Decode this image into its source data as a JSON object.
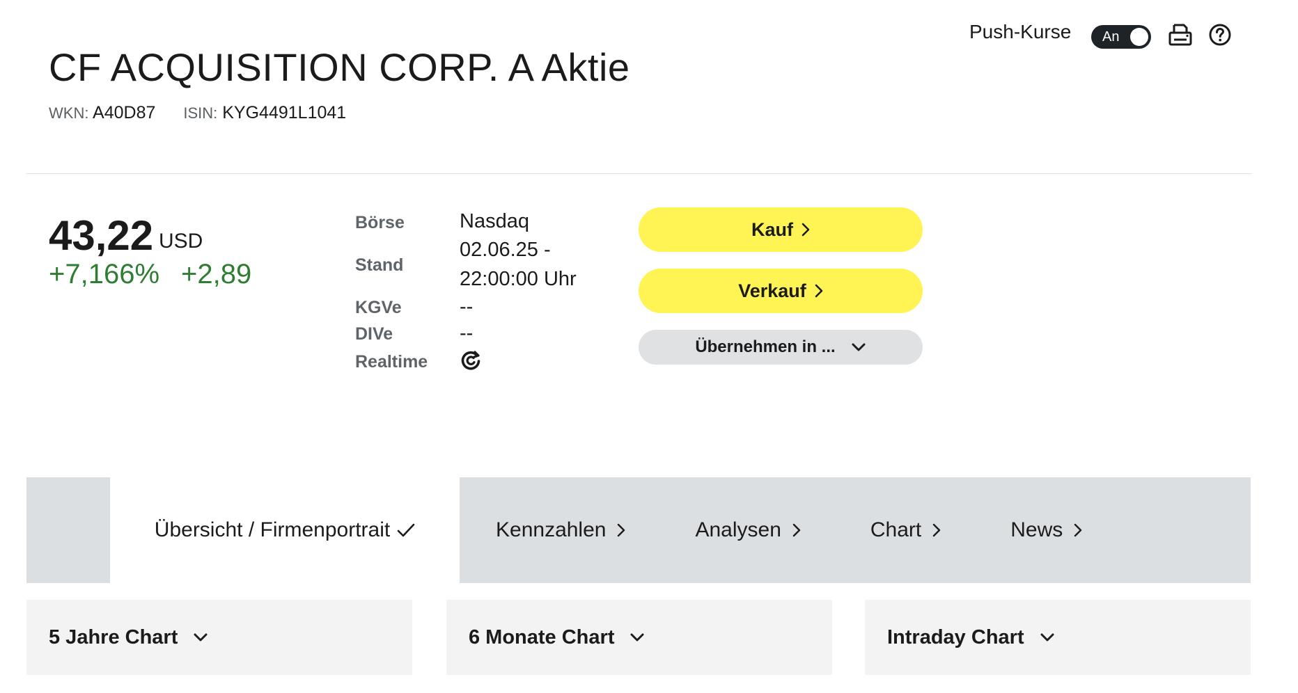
{
  "header": {
    "push_label": "Push-Kurse",
    "push_toggle_state": "An",
    "title": "CF ACQUISITION CORP. A Aktie",
    "wkn_label": "WKN:",
    "wkn_value": "A40D87",
    "isin_label": "ISIN:",
    "isin_value": "KYG4491L1041",
    "icons": [
      "print-icon",
      "help-icon"
    ]
  },
  "quote": {
    "price": "43,22",
    "currency": "USD",
    "change_pct": "+7,166%",
    "change_abs": "+2,89",
    "change_color": "#2e7d32"
  },
  "info": {
    "exchange_label": "Börse",
    "exchange_value": "Nasdaq",
    "stand_label": "Stand",
    "stand_line1": "02.06.25 -",
    "stand_line2": "22:00:00 Uhr",
    "kgve_label": "KGVe",
    "kgve_value": "--",
    "dive_label": "DIVe",
    "dive_value": "--",
    "realtime_label": "Realtime",
    "realtime_icon": "refresh-icon"
  },
  "actions": {
    "buy_label": "Kauf",
    "sell_label": "Verkauf",
    "transfer_label": "Übernehmen in ...",
    "accent_color": "#fff453"
  },
  "tabs": [
    {
      "label": "Übersicht / Firmenportrait",
      "active": true
    },
    {
      "label": "Kennzahlen"
    },
    {
      "label": "Analysen"
    },
    {
      "label": "Chart"
    },
    {
      "label": "News"
    }
  ],
  "charts": [
    {
      "label": "5 Jahre Chart"
    },
    {
      "label": "6 Monate Chart"
    },
    {
      "label": "Intraday Chart"
    }
  ]
}
